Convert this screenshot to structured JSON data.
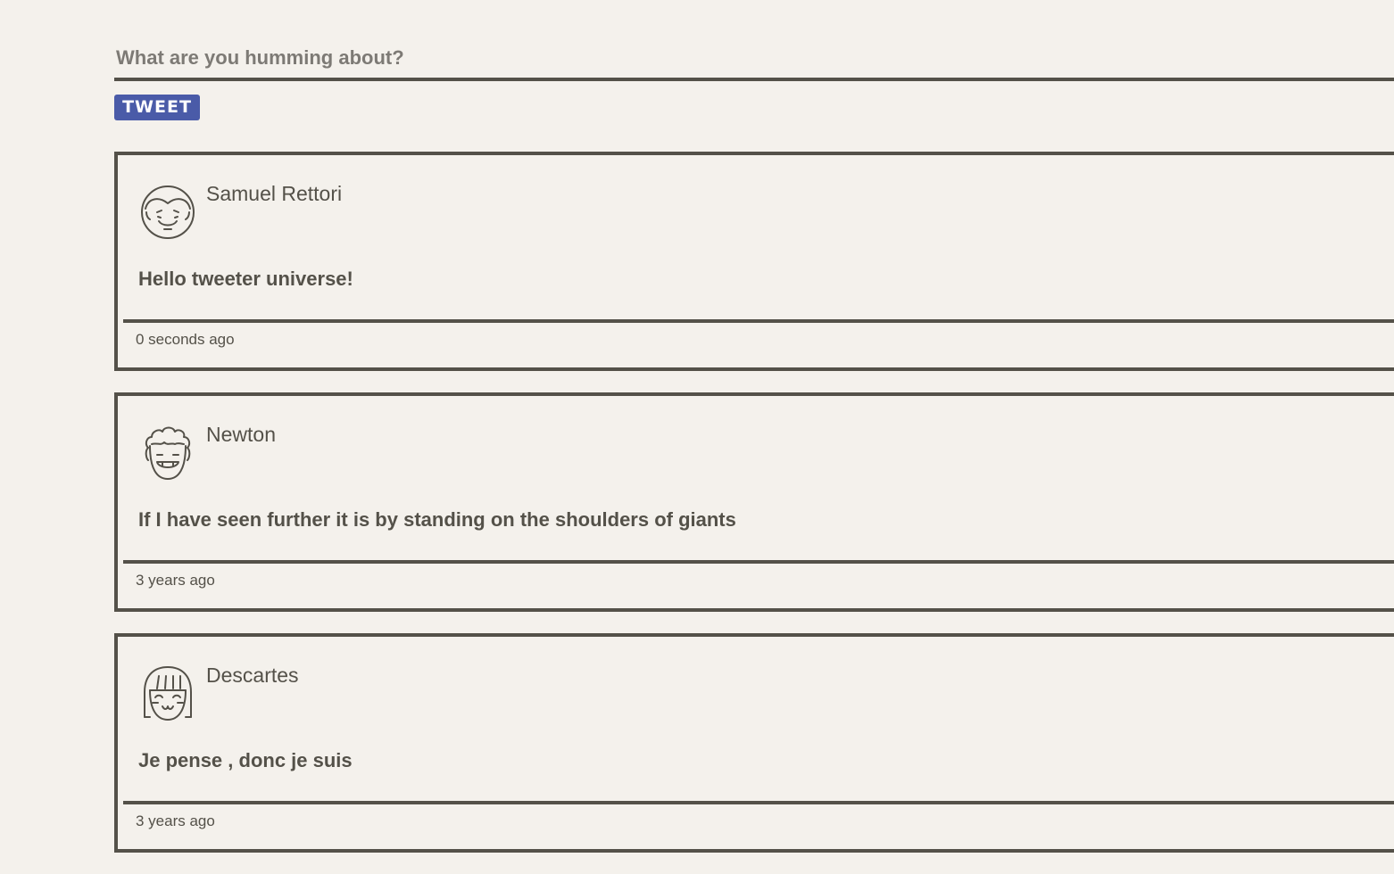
{
  "compose": {
    "placeholder": "What are you humming about?",
    "value": "",
    "button_label": "TWEET",
    "button_color": "#4a5ba8"
  },
  "tweets": [
    {
      "author": "Samuel Rettori",
      "avatar_icon": "man-face-icon",
      "content": "Hello tweeter universe!",
      "timestamp": "0 seconds ago"
    },
    {
      "author": "Newton",
      "avatar_icon": "curly-hair-face-icon",
      "content": "If I have seen further it is by standing on the shoulders of giants",
      "timestamp": "3 years ago"
    },
    {
      "author": "Descartes",
      "avatar_icon": "bob-hair-face-icon",
      "content": "Je pense , donc je suis",
      "timestamp": "3 years ago"
    }
  ],
  "colors": {
    "background": "#f4f1ec",
    "text": "#545149",
    "border": "#545149"
  }
}
